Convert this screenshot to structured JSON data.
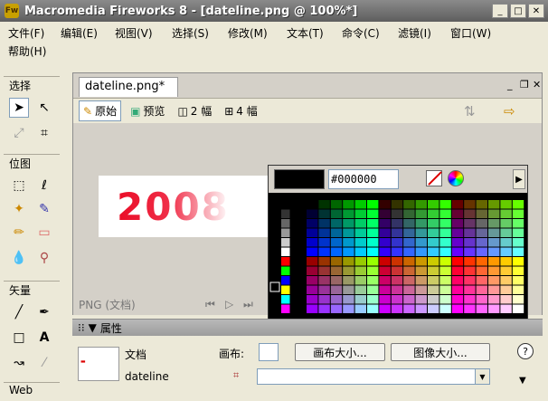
{
  "window": {
    "title": "Macromedia Fireworks 8 - [dateline.png @ 100%*]"
  },
  "menu": [
    {
      "label": "文件(F)"
    },
    {
      "label": "编辑(E)"
    },
    {
      "label": "视图(V)"
    },
    {
      "label": "选择(S)"
    },
    {
      "label": "修改(M)"
    },
    {
      "label": "文本(T)"
    },
    {
      "label": "命令(C)"
    },
    {
      "label": "滤镜(I)"
    },
    {
      "label": "窗口(W)"
    },
    {
      "label": "帮助(H)"
    }
  ],
  "toolbox": {
    "select_section": "选择",
    "bitmap_section": "位图",
    "vector_section": "矢量",
    "web_section": "Web"
  },
  "document": {
    "tab_label": "dateline.png*",
    "views": [
      {
        "label": "原始"
      },
      {
        "label": "预览"
      },
      {
        "label": "2 幅"
      },
      {
        "label": "4 幅"
      }
    ],
    "image_text": "2008",
    "status": "PNG (文档)"
  },
  "palette": {
    "current_hex": "#000000",
    "current_color": "#000000"
  },
  "properties": {
    "header": "属性",
    "doc_type": "文档",
    "doc_name": "dateline",
    "canvas_label": "画布:",
    "canvas_size_btn": "画布大小...",
    "image_size_btn": "图像大小...",
    "help": "?"
  }
}
